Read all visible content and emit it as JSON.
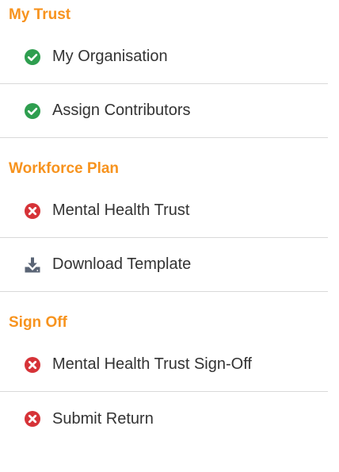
{
  "colors": {
    "section_heading": "#f7931e",
    "status_complete": "#2e9e4f",
    "status_incomplete": "#d63338",
    "download_icon": "#5a6475",
    "divider": "#d9d9d9"
  },
  "sections": [
    {
      "title": "My Trust",
      "items": [
        {
          "label": "My Organisation",
          "icon": "check-circle-icon"
        },
        {
          "label": "Assign Contributors",
          "icon": "check-circle-icon"
        }
      ]
    },
    {
      "title": "Workforce Plan",
      "items": [
        {
          "label": "Mental Health Trust",
          "icon": "x-circle-icon"
        },
        {
          "label": "Download Template",
          "icon": "download-icon"
        }
      ]
    },
    {
      "title": "Sign Off",
      "items": [
        {
          "label": "Mental Health Trust Sign-Off",
          "icon": "x-circle-icon"
        },
        {
          "label": "Submit Return",
          "icon": "x-circle-icon"
        }
      ]
    }
  ]
}
